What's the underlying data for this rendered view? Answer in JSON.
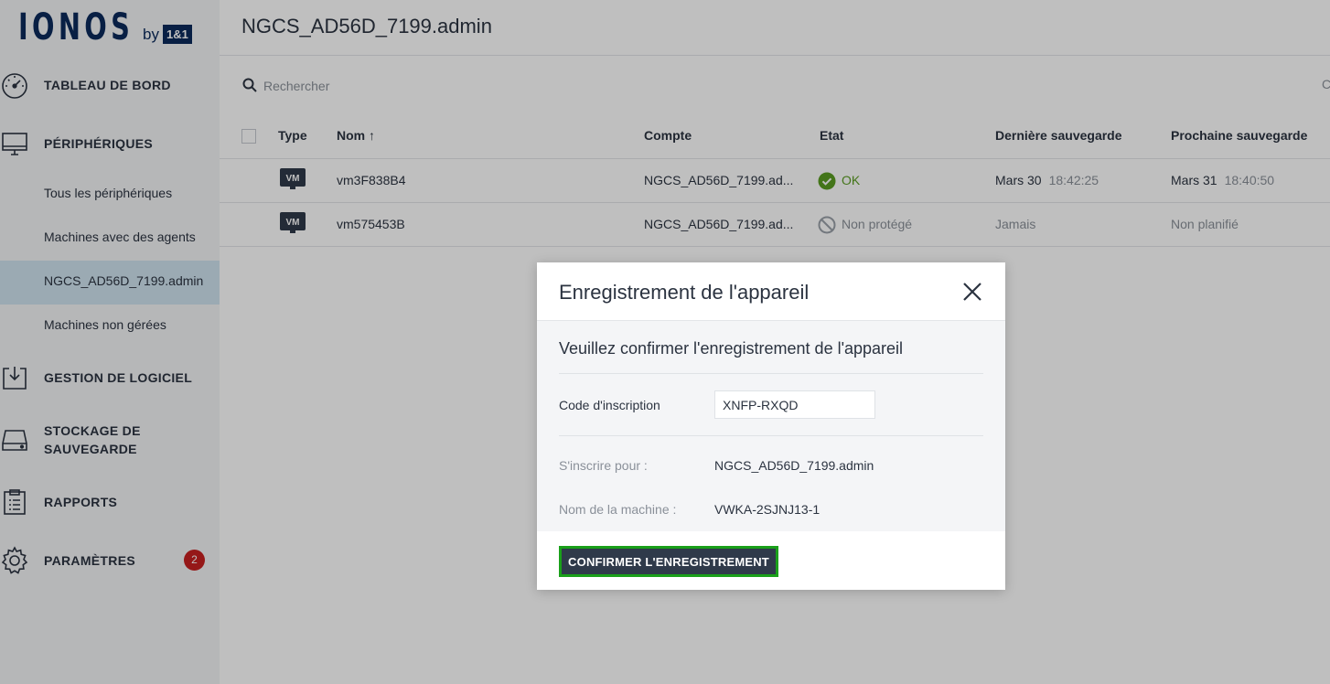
{
  "brand": {
    "name": "IONOS",
    "by": "by",
    "partner": "1&1"
  },
  "sidebar": {
    "items": [
      {
        "label": "TABLEAU DE BORD",
        "icon": "dashboard-gauge-icon"
      },
      {
        "label": "PÉRIPHÉRIQUES",
        "icon": "monitor-icon"
      },
      {
        "label": "GESTION DE LOGICIEL",
        "icon": "download-tray-icon"
      },
      {
        "label": "STOCKAGE DE SAUVEGARDE",
        "icon": "drive-icon"
      },
      {
        "label": "RAPPORTS",
        "icon": "clipboard-icon"
      },
      {
        "label": "PARAMÈTRES",
        "icon": "gear-icon",
        "badge": "2"
      }
    ],
    "subitems": [
      {
        "label": "Tous les périphériques"
      },
      {
        "label": "Machines avec des agents"
      },
      {
        "label": "NGCS_AD56D_7199.admin",
        "active": true
      },
      {
        "label": "Machines non gérées"
      }
    ]
  },
  "header": {
    "title": "NGCS_AD56D_7199.admin"
  },
  "search": {
    "placeholder": "Rechercher",
    "clipped_text": "C"
  },
  "table": {
    "columns": [
      "Type",
      "Nom",
      "Compte",
      "Etat",
      "Dernière sauvegarde",
      "Prochaine sauvegarde"
    ],
    "sort_indicator": "↑",
    "rows": [
      {
        "type": "VM",
        "name": "vm3F838B4",
        "account": "NGCS_AD56D_7199.ad...",
        "status": "OK",
        "status_kind": "ok",
        "last_date": "Mars 30",
        "last_time": "18:42:25",
        "next_date": "Mars 31",
        "next_time": "18:40:50"
      },
      {
        "type": "VM",
        "name": "vm575453B",
        "account": "NGCS_AD56D_7199.ad...",
        "status": "Non protégé",
        "status_kind": "unprotected",
        "last_date": "Jamais",
        "last_time": "",
        "next_date": "Non planifié",
        "next_time": ""
      }
    ]
  },
  "modal": {
    "title": "Enregistrement de l'appareil",
    "subtitle": "Veuillez confirmer l'enregistrement de l'appareil",
    "code_label": "Code d'inscription",
    "code_value": "XNFP-RXQD",
    "enroll_for_label": "S'inscrire pour :",
    "enroll_for_value": "NGCS_AD56D_7199.admin",
    "machine_label": "Nom de la machine :",
    "machine_value": "VWKA-2SJNJ13-1",
    "confirm_label": "CONFIRMER L'ENREGISTREMENT"
  },
  "colors": {
    "accent_ok": "#5a9c22",
    "badge": "#c72020",
    "brand": "#0b2a5b",
    "confirm_button": "#2f3a4a",
    "confirm_outline": "#1aa01a",
    "active_row": "#cfe3ef"
  }
}
